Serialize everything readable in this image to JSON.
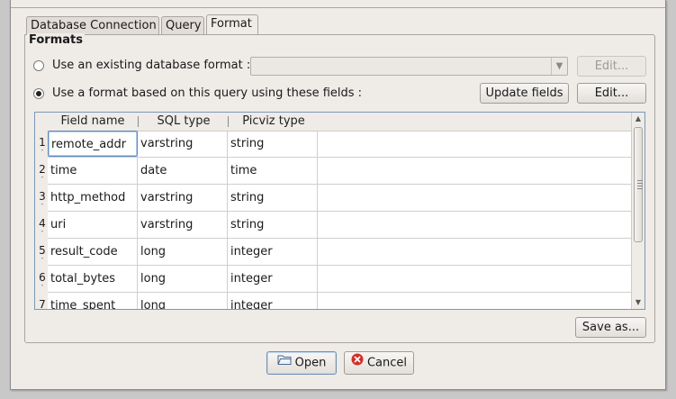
{
  "tabs": [
    {
      "label": "Database Connection",
      "active": false
    },
    {
      "label": "Query",
      "active": false
    },
    {
      "label": "Format",
      "active": true
    }
  ],
  "formats": {
    "group_title": "Formats",
    "existing_option_label": "Use an existing database format :",
    "existing_option_checked": false,
    "existing_combo_value": "",
    "existing_edit_label": "Edit...",
    "query_option_label": "Use a format based on this query using these fields :",
    "query_option_checked": true,
    "update_fields_label": "Update fields",
    "query_edit_label": "Edit..."
  },
  "table": {
    "columns": [
      "Field name",
      "SQL type",
      "Picviz type"
    ],
    "rows": [
      {
        "num": "1",
        "field": "remote_addr",
        "sql": "varstring",
        "picviz": "string"
      },
      {
        "num": "2",
        "field": "time",
        "sql": "date",
        "picviz": "time"
      },
      {
        "num": "3",
        "field": "http_method",
        "sql": "varstring",
        "picviz": "string"
      },
      {
        "num": "4",
        "field": "uri",
        "sql": "varstring",
        "picviz": "string"
      },
      {
        "num": "5",
        "field": "result_code",
        "sql": "long",
        "picviz": "integer"
      },
      {
        "num": "6",
        "field": "total_bytes",
        "sql": "long",
        "picviz": "integer"
      },
      {
        "num": "7",
        "field": "time_spent",
        "sql": "long",
        "picviz": "integer"
      }
    ]
  },
  "save_as_label": "Save as...",
  "open_label": "Open",
  "cancel_label": "Cancel",
  "colors": {
    "accent": "#5d8bc0",
    "cancel_icon": "#d0302a"
  }
}
